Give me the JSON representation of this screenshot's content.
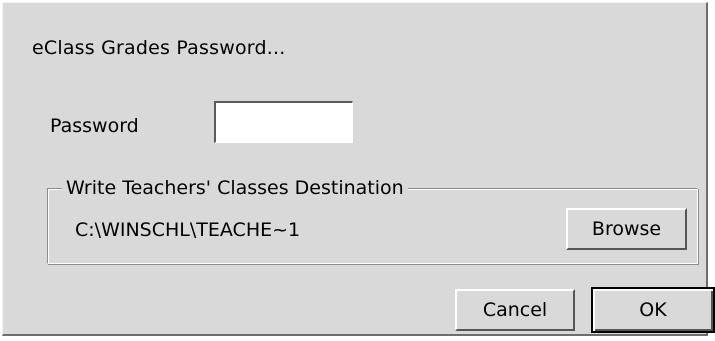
{
  "dialog": {
    "title": "eClass Grades Password..."
  },
  "password": {
    "label": "Password",
    "value": ""
  },
  "destination": {
    "group_title": "Write Teachers' Classes Destination",
    "path": "C:\\WINSCHL\\TEACHE~1",
    "browse_label": "Browse"
  },
  "buttons": {
    "cancel_label": "Cancel",
    "ok_label": "OK"
  }
}
